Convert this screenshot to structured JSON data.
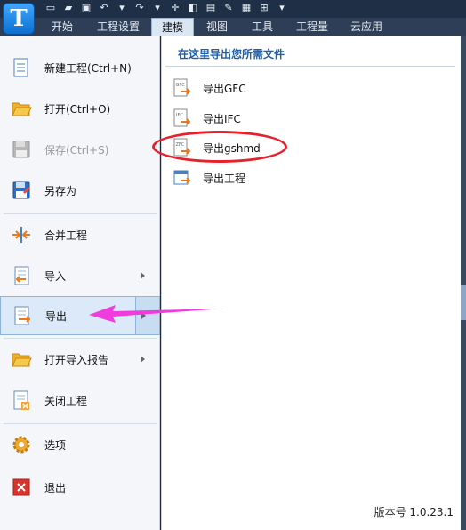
{
  "ribbon": {
    "tabs": [
      {
        "id": "start",
        "label": "开始"
      },
      {
        "id": "project-settings",
        "label": "工程设置"
      },
      {
        "id": "modeling",
        "label": "建模",
        "active": true
      },
      {
        "id": "view",
        "label": "视图"
      },
      {
        "id": "tools",
        "label": "工具"
      },
      {
        "id": "quantities",
        "label": "工程量"
      },
      {
        "id": "cloud",
        "label": "云应用"
      }
    ]
  },
  "file_menu": {
    "items": [
      {
        "id": "new-project",
        "label": "新建工程(Ctrl+N)",
        "icon": "new-file-icon"
      },
      {
        "id": "open",
        "label": "打开(Ctrl+O)",
        "icon": "open-folder-icon"
      },
      {
        "id": "save",
        "label": "保存(Ctrl+S)",
        "icon": "save-disk-icon",
        "disabled": true
      },
      {
        "id": "save-as",
        "label": "另存为",
        "icon": "save-as-icon"
      },
      {
        "id": "merge-project",
        "label": "合并工程",
        "icon": "merge-icon"
      },
      {
        "id": "import",
        "label": "导入",
        "icon": "import-icon",
        "submenu": true
      },
      {
        "id": "export",
        "label": "导出",
        "icon": "export-icon",
        "submenu": true,
        "selected": true
      },
      {
        "id": "open-import-report",
        "label": "打开导入报告",
        "icon": "open-report-icon",
        "submenu": true
      },
      {
        "id": "close-project",
        "label": "关闭工程",
        "icon": "close-file-icon"
      },
      {
        "id": "options",
        "label": "选项",
        "icon": "gear-icon"
      },
      {
        "id": "exit",
        "label": "退出",
        "icon": "exit-icon"
      }
    ]
  },
  "export_panel": {
    "header": "在这里导出您所需文件",
    "items": [
      {
        "id": "export-gfc",
        "label": "导出GFC",
        "icon": "gfc-file-icon"
      },
      {
        "id": "export-ifc",
        "label": "导出IFC",
        "icon": "ifc-file-icon"
      },
      {
        "id": "export-gshmd",
        "label": "导出gshmd",
        "icon": "zfc-file-icon"
      },
      {
        "id": "export-project",
        "label": "导出工程",
        "icon": "export-project-icon"
      }
    ],
    "version": "版本号 1.0.23.1"
  },
  "colors": {
    "accent": "#1d5fa8",
    "annotation_red": "#e8202c",
    "annotation_magenta": "#f03cdc"
  }
}
